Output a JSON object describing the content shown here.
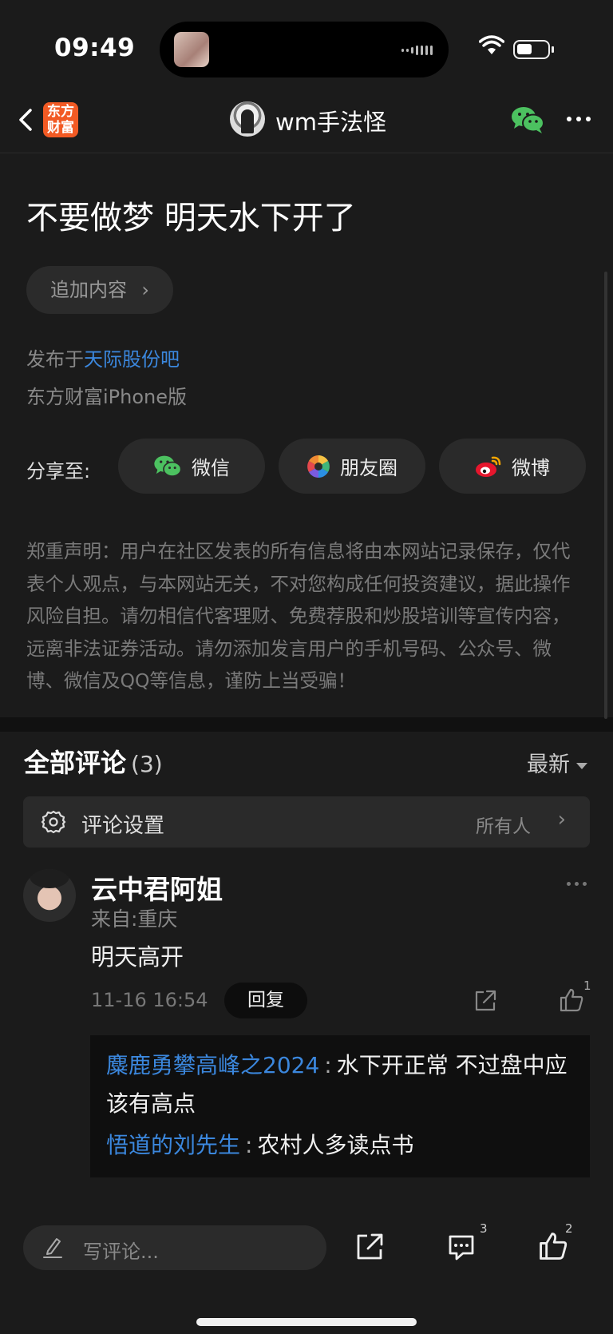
{
  "status_bar": {
    "time": "09:49",
    "battery_level": 0.5
  },
  "nav": {
    "app_logo_text": "东方财富",
    "author_name": "wm手法怪",
    "icons": [
      "back-icon",
      "wechat-icon",
      "more-icon"
    ]
  },
  "post": {
    "title": "不要做梦 明天水下开了",
    "append_label": "追加内容",
    "forum_prefix": "发布于",
    "forum_name": "天际股份吧",
    "source": "东方财富iPhone版"
  },
  "share": {
    "label": "分享至:",
    "targets": [
      {
        "label": "微信",
        "icon": "wechat-icon"
      },
      {
        "label": "朋友圈",
        "icon": "moments-icon"
      },
      {
        "label": "微博",
        "icon": "weibo-icon"
      }
    ]
  },
  "disclaimer": "郑重声明：用户在社区发表的所有信息将由本网站记录保存，仅代表个人观点，与本网站无关，不对您构成任何投资建议，据此操作风险自担。请勿相信代客理财、免费荐股和炒股培训等宣传内容，远离非法证券活动。请勿添加发言用户的手机号码、公众号、微博、微信及QQ等信息，谨防上当受骗！",
  "comments": {
    "title": "全部评论",
    "count": "(3)",
    "sort_label": "最新",
    "settings_label": "评论设置",
    "settings_value": "所有人",
    "items": [
      {
        "name": "云中君阿姐",
        "location": "来自:重庆",
        "text": "明天高开",
        "time": "11-16 16:54",
        "reply_label": "回复",
        "likes": "1",
        "replies": [
          {
            "user": "麋鹿勇攀高峰之2024",
            "text": "水下开正常 不过盘中应该有高点"
          },
          {
            "user": "悟道的刘先生",
            "text": "农村人多读点书"
          }
        ]
      }
    ]
  },
  "bottom_bar": {
    "placeholder": "写评论...",
    "comment_count": "3",
    "like_count": "2"
  },
  "colors": {
    "background": "#1b1b1b",
    "link": "#3b87dd",
    "brand": "#f25a24",
    "wechat": "#4cc160"
  }
}
